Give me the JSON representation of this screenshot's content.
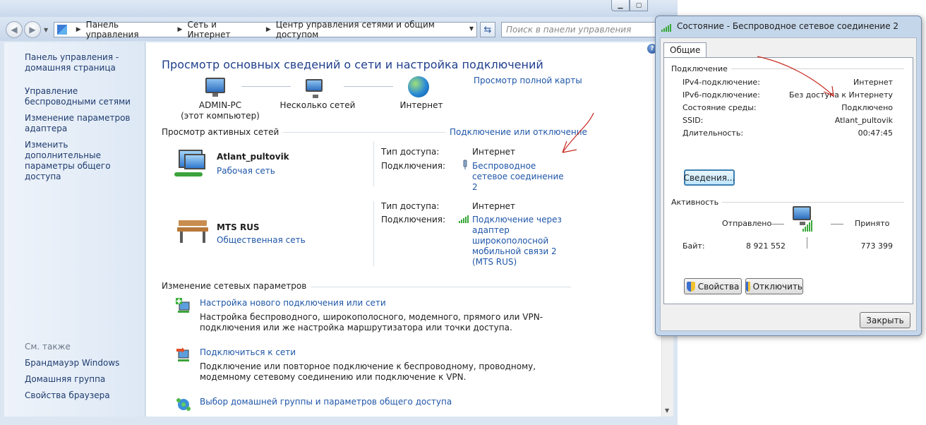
{
  "nav": {
    "breadcrumb": [
      "Панель управления",
      "Сеть и Интернет",
      "Центр управления сетями и общим доступом"
    ],
    "search_placeholder": "Поиск в панели управления"
  },
  "sidebar": {
    "links": [
      "Панель управления - домашняя страница",
      "Управление беспроводными сетями",
      "Изменение параметров адаптера",
      "Изменить дополнительные параметры общего доступа"
    ],
    "see_also_label": "См. также",
    "see_also": [
      "Брандмауэр Windows",
      "Домашняя группа",
      "Свойства браузера"
    ]
  },
  "main": {
    "title": "Просмотр основных сведений о сети и настройка подключений",
    "view_full_map": "Просмотр полной карты",
    "map": {
      "computer": "ADMIN-PC",
      "computer_sub": "(этот компьютер)",
      "middle": "Несколько сетей",
      "internet": "Интернет"
    },
    "active_networks_label": "Просмотр активных сетей",
    "connect_disconnect": "Подключение или отключение",
    "networks": [
      {
        "name": "Atlant_pultovik",
        "type": "Рабочая сеть",
        "access_label": "Тип доступа:",
        "access_value": "Интернет",
        "connections_label": "Подключения:",
        "connection": "Беспроводное сетевое соединение 2"
      },
      {
        "name": "MTS RUS",
        "type": "Общественная сеть",
        "access_label": "Тип доступа:",
        "access_value": "Интернет",
        "connections_label": "Подключения:",
        "connection": "Подключение через адаптер широкополосной мобильной связи 2 (MTS RUS)"
      }
    ],
    "change_settings_label": "Изменение сетевых параметров",
    "tasks": [
      {
        "title": "Настройка нового подключения или сети",
        "desc": "Настройка беспроводного, широкополосного, модемного, прямого или VPN-подключения или же настройка маршрутизатора или точки доступа."
      },
      {
        "title": "Подключиться к сети",
        "desc": "Подключение или повторное подключение к беспроводному, проводному, модемному сетевому соединению или подключение к VPN."
      },
      {
        "title": "Выбор домашней группы и параметров общего доступа",
        "desc": ""
      }
    ]
  },
  "dialog": {
    "title": "Состояние - Беспроводное сетевое соединение 2",
    "tab": "Общие",
    "connection_label": "Подключение",
    "rows": [
      {
        "label": "IPv4-подключение:",
        "value": "Интернет"
      },
      {
        "label": "IPv6-подключение:",
        "value": "Без доступа к Интернету"
      },
      {
        "label": "Состояние среды:",
        "value": "Подключено"
      },
      {
        "label": "SSID:",
        "value": "Atlant_pultovik"
      },
      {
        "label": "Длительность:",
        "value": "00:47:45"
      }
    ],
    "details_button": "Сведения...",
    "activity_label": "Активность",
    "sent_label": "Отправлено",
    "received_label": "Принято",
    "bytes_label": "Байт:",
    "bytes_sent": "8 921 552",
    "bytes_received": "773 399",
    "properties_button": "Свойства",
    "disable_button": "Отключить",
    "close_button": "Закрыть"
  }
}
